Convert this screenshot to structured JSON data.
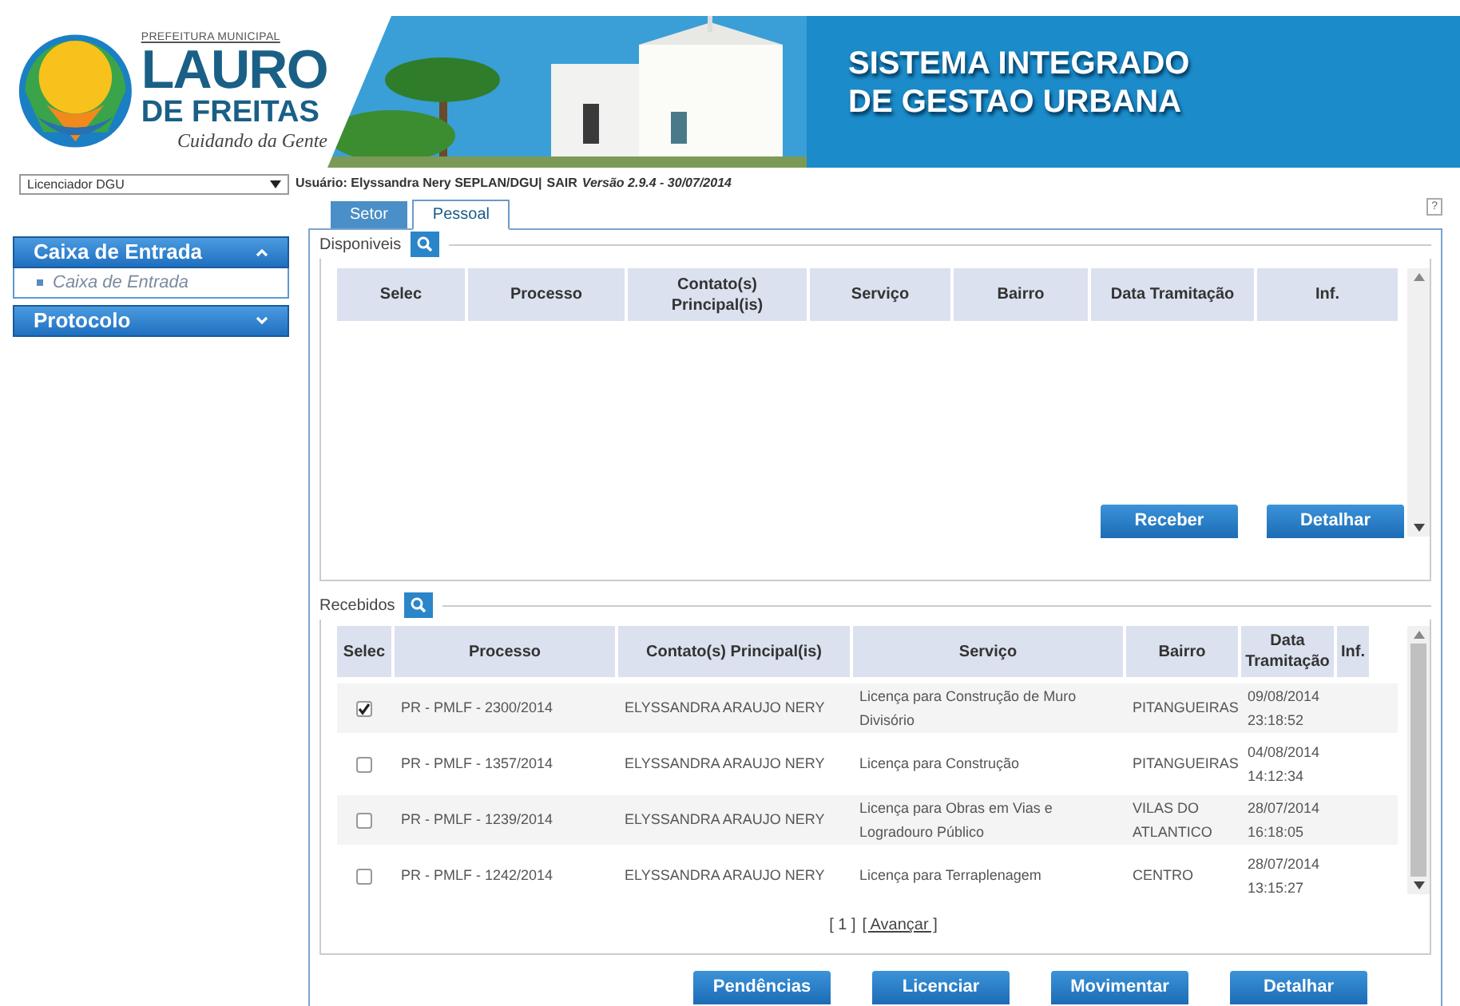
{
  "logo": {
    "prefix": "PREFEITURA MUNICIPAL",
    "line1": "LAURO",
    "line2": "DE FREITAS",
    "slogan": "Cuidando da Gente"
  },
  "banner": {
    "title_line1": "SISTEMA INTEGRADO",
    "title_line2": "DE GESTAO URBANA"
  },
  "profile_select": {
    "value": "Licenciador DGU"
  },
  "user_bar": {
    "text": "Usuário: Elyssandra Nery SEPLAN/DGU|",
    "logout": "SAIR",
    "version": "Versão 2.9.4 - 30/07/2014"
  },
  "help": "?",
  "tabs": [
    {
      "label": "Setor",
      "selected": false
    },
    {
      "label": "Pessoal",
      "selected": true
    }
  ],
  "sidebar": [
    {
      "label": "Caixa de Entrada",
      "expanded": true,
      "children": [
        {
          "label": "Caixa de Entrada"
        }
      ]
    },
    {
      "label": "Protocolo",
      "expanded": false
    }
  ],
  "available": {
    "legend": "Disponiveis",
    "columns": [
      "Selec",
      "Processo",
      "Contato(s) Principal(is)",
      "Serviço",
      "Bairro",
      "Data Tramitação",
      "Inf."
    ],
    "buttons": [
      "Receber",
      "Detalhar"
    ]
  },
  "received": {
    "legend": "Recebidos",
    "columns": [
      "Selec",
      "Processo",
      "Contato(s) Principal(is)",
      "Serviço",
      "Bairro",
      "Data Tramitação",
      "Inf."
    ],
    "rows": [
      {
        "checked": true,
        "process": "PR - PMLF - 2300/2014",
        "contact": "ELYSSANDRA ARAUJO NERY",
        "service": "Licença para Construção de Muro Divisório",
        "district": "PITANGUEIRAS",
        "date": "09/08/2014 23:18:52"
      },
      {
        "checked": false,
        "process": "PR - PMLF - 1357/2014",
        "contact": "ELYSSANDRA ARAUJO NERY",
        "service": "Licença para Construção",
        "district": "PITANGUEIRAS",
        "date": "04/08/2014 14:12:34"
      },
      {
        "checked": false,
        "process": "PR - PMLF - 1239/2014",
        "contact": "ELYSSANDRA ARAUJO NERY",
        "service": "Licença para Obras em Vias e Logradouro Público",
        "district": "VILAS DO ATLANTICO",
        "date": "28/07/2014 16:18:05"
      },
      {
        "checked": false,
        "process": "PR - PMLF - 1242/2014",
        "contact": "ELYSSANDRA ARAUJO NERY",
        "service": "Licença para Terraplenagem",
        "district": "CENTRO",
        "date": "28/07/2014 13:15:27"
      }
    ],
    "pager": {
      "current": "[ 1 ]",
      "next": "[ Avançar ]"
    }
  },
  "buttons": [
    "Pendências",
    "Licenciar",
    "Movimentar",
    "Detalhar"
  ]
}
